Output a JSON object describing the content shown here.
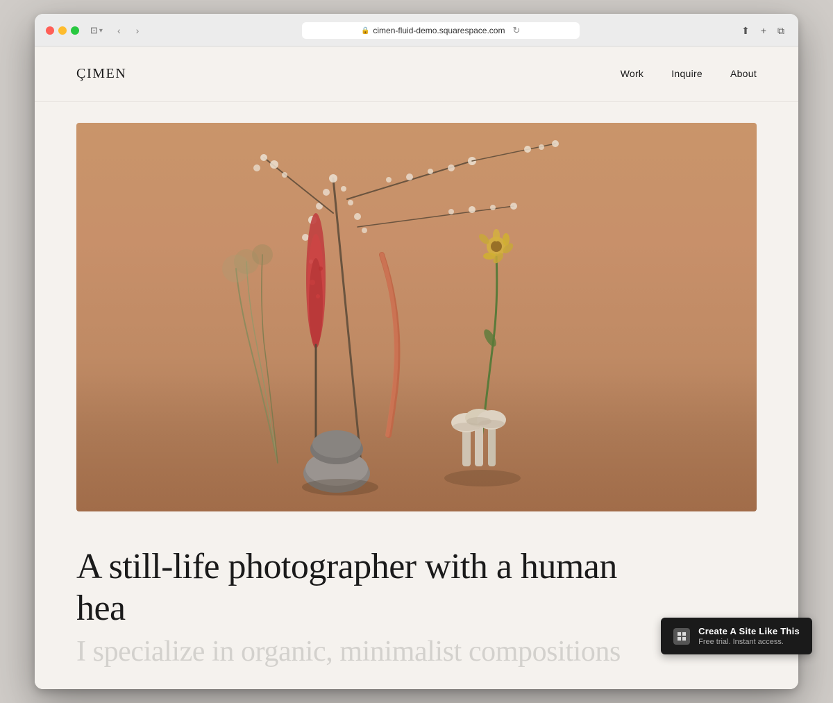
{
  "browser": {
    "url": "cimen-fluid-demo.squarespace.com",
    "traffic_lights": [
      "red",
      "yellow",
      "green"
    ],
    "back_label": "‹",
    "forward_label": "›",
    "refresh_label": "↻",
    "share_label": "⬆",
    "new_tab_label": "+",
    "duplicate_label": "⧉"
  },
  "site": {
    "logo": "ÇIMEN",
    "nav": {
      "links": [
        {
          "label": "Work",
          "href": "#"
        },
        {
          "label": "Inquire",
          "href": "#"
        },
        {
          "label": "About",
          "href": "#"
        }
      ]
    },
    "hero": {
      "alt": "Still life arrangement with flowers on stone bases and mushrooms"
    },
    "heading_line1": "A still-life photographer with a human hea",
    "heading_line2": "I specialize in organic, minimalist compositions"
  },
  "badge": {
    "main_text": "Create A Site Like This",
    "sub_text": "Free trial. Instant access.",
    "logo_text": "S"
  }
}
